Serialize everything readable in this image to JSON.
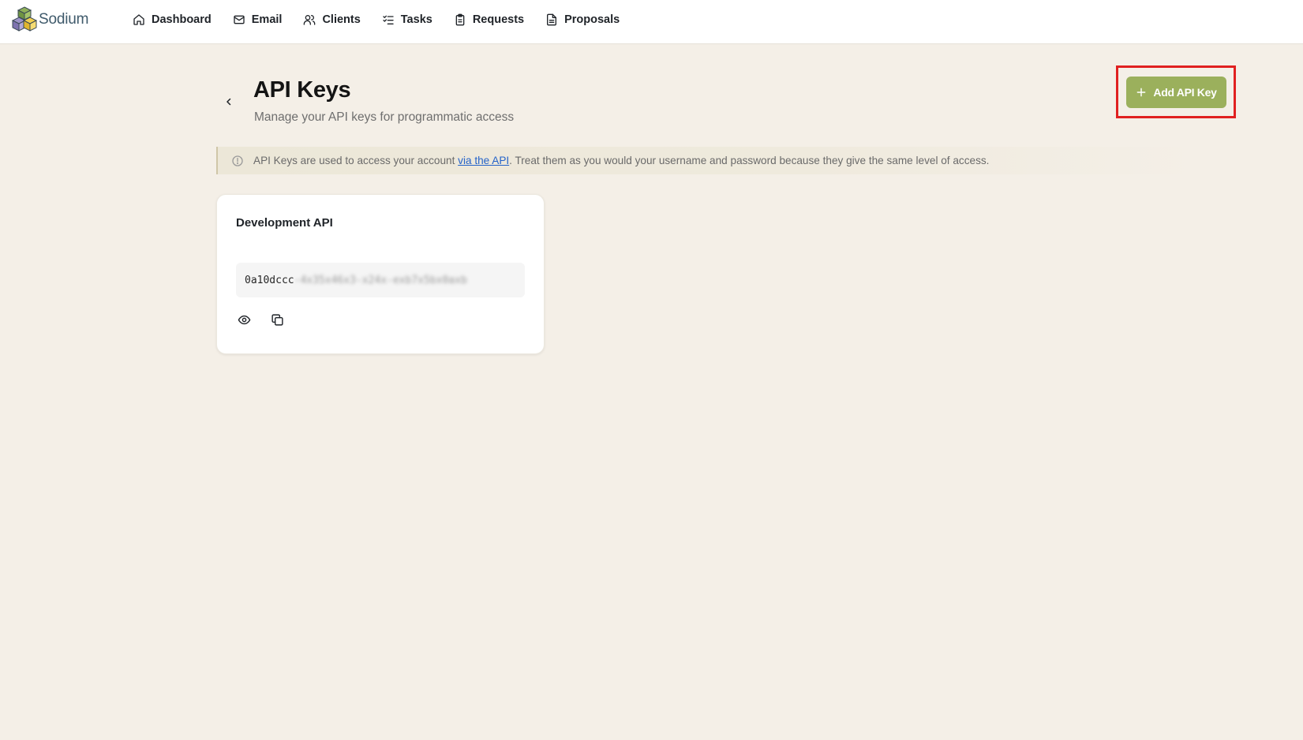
{
  "brand": {
    "name": "Sodium",
    "logo_icon": "cubes-logo-icon"
  },
  "nav": {
    "items": [
      {
        "label": "Dashboard",
        "icon": "home-icon"
      },
      {
        "label": "Email",
        "icon": "mail-icon"
      },
      {
        "label": "Clients",
        "icon": "users-icon"
      },
      {
        "label": "Tasks",
        "icon": "checklist-icon"
      },
      {
        "label": "Requests",
        "icon": "clipboard-icon"
      },
      {
        "label": "Proposals",
        "icon": "document-icon"
      }
    ]
  },
  "header": {
    "title": "API Keys",
    "subtitle": "Manage your API keys for programmatic access",
    "add_button_label": "Add API Key"
  },
  "banner": {
    "text_before": "API Keys are used to access your account ",
    "link_text": "via the API",
    "text_after": ". Treat them as you would your username and password because they give the same level of access."
  },
  "keys": [
    {
      "name": "Development API",
      "key_prefix": "0a10dccc",
      "key_masked": "-4x35x46x3-x24x-exb7x5bx0axb"
    }
  ],
  "colors": {
    "accent": "#9bb05c",
    "highlight": "#e02020",
    "background": "#f4efe7",
    "link": "#2563c9"
  }
}
